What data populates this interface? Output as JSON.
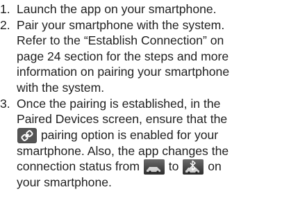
{
  "steps": [
    {
      "number": "1.",
      "text": "Launch the app on your smartphone."
    },
    {
      "number": "2.",
      "text": "Pair your smartphone with the system.\nRefer to the “Establish Connection” on\npage 24 section for the steps and more\ninformation on pairing your smartphone\nwith the system."
    },
    {
      "number": "3.",
      "text_a": "Once the pairing is established, in the\nPaired Devices screen, ensure that the",
      "text_b": "pairing option is enabled for your\nsmartphone. Also, the app changes the\nconnection status from",
      "text_c": "to",
      "text_d": "on\nyour smartphone.",
      "icons": {
        "pairing_option": "phone-link-icon",
        "status_disconnected": "car-disconnected-icon",
        "status_connected": "car-bluetooth-connected-icon"
      }
    }
  ],
  "colors": {
    "text": "#1f1f1f",
    "icon_tile": "#4a4a4a",
    "icon_tile_light": "#8a8a8a"
  }
}
